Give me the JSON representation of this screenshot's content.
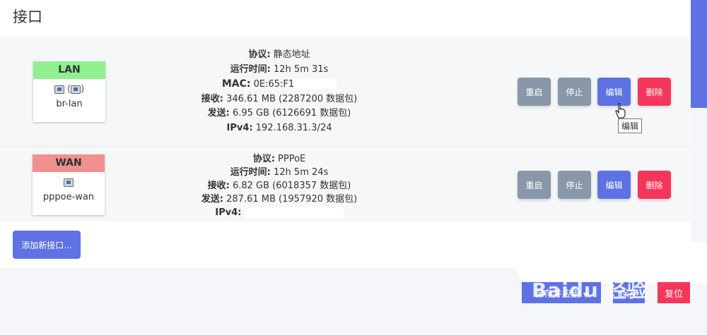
{
  "page": {
    "title": "接口"
  },
  "interfaces": [
    {
      "name_label": "LAN",
      "device": "br-lan",
      "icons": [
        "network-port-icon",
        "bridge-icon"
      ],
      "protocol_label": "协议:",
      "protocol": "静态地址",
      "uptime_label": "运行时间:",
      "uptime": "12h 5m 31s",
      "mac_label": "MAC:",
      "mac": "0E:65:F1",
      "rx_label": "接收:",
      "rx": "346.61 MB (2287200 数据包)",
      "tx_label": "发送:",
      "tx": "6.95 GB (6126691 数据包)",
      "ipv4_label": "IPv4:",
      "ipv4": "192.168.31.3/24"
    },
    {
      "name_label": "WAN",
      "device": "pppoe-wan",
      "icons": [
        "pppoe-icon"
      ],
      "protocol_label": "协议:",
      "protocol": "PPPoE",
      "uptime_label": "运行时间:",
      "uptime": "12h 5m 24s",
      "rx_label": "接收:",
      "rx": "6.82 GB (6018357 数据包)",
      "tx_label": "发送:",
      "tx": "287.61 MB (1957920 数据包)",
      "ipv4_label": "IPv4:"
    }
  ],
  "row_actions": {
    "restart": "重启",
    "stop": "停止",
    "edit": "编辑",
    "delete": "删除"
  },
  "tooltip": "编辑",
  "add_button": "添加新接口...",
  "footer": {
    "save_apply": "保存并应用",
    "save": "保存",
    "reset": "复位"
  },
  "watermark": "Baidu 经验",
  "colors": {
    "primary": "#5e72e4",
    "danger": "#f5365c",
    "neutral": "#8898aa",
    "lan_header": "#90f090",
    "wan_header": "#f09090"
  }
}
